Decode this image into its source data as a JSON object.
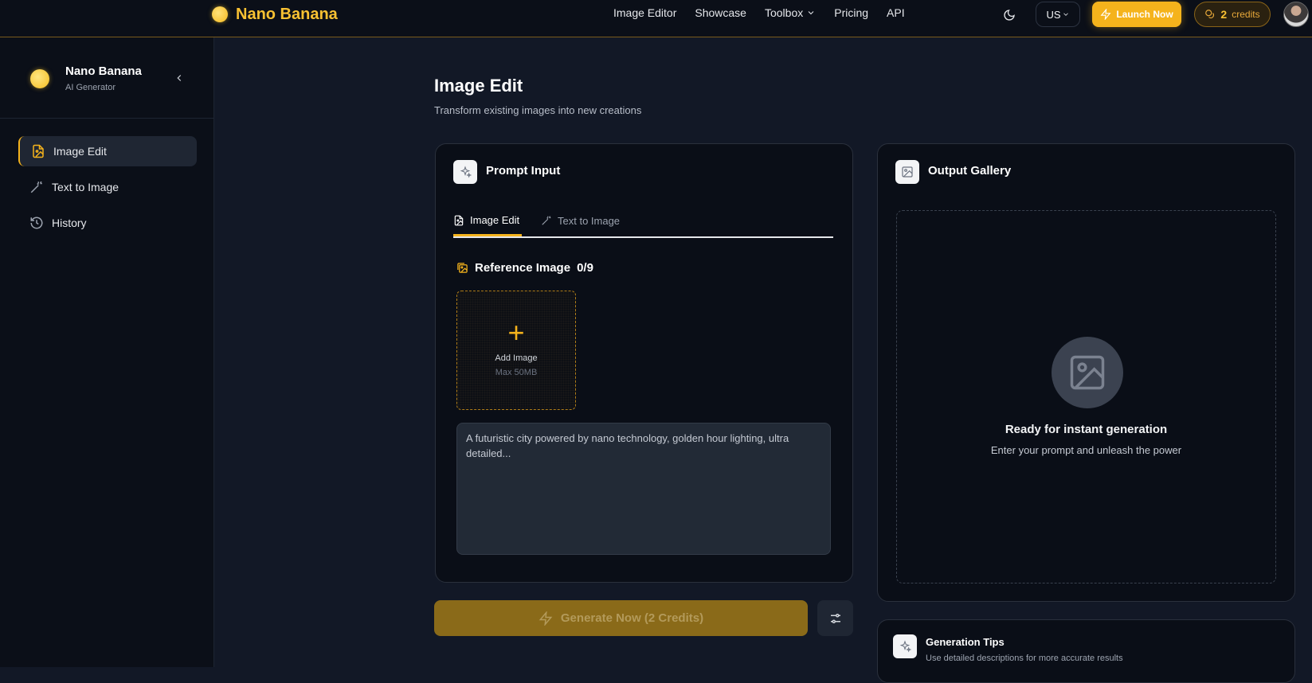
{
  "header": {
    "brand": "Nano Banana",
    "nav": [
      "Image Editor",
      "Showcase",
      "Toolbox",
      "Pricing",
      "API"
    ],
    "lang": "US",
    "launch_label": "Launch Now",
    "credits_count": "2",
    "credits_label": "credits"
  },
  "sidebar": {
    "title": "Nano Banana",
    "subtitle": "AI Generator",
    "items": [
      {
        "label": "Image Edit",
        "icon": "image-edit-icon",
        "active": true
      },
      {
        "label": "Text to Image",
        "icon": "magic-wand-icon"
      },
      {
        "label": "History",
        "icon": "history-icon"
      }
    ]
  },
  "main": {
    "title": "Image Edit",
    "subtitle": "Transform existing images into new creations",
    "prompt_card": {
      "title": "Prompt Input",
      "tabs": [
        "Image Edit",
        "Text to Image"
      ],
      "reference_label": "Reference Image",
      "reference_count": "0/9",
      "add_image": "Add Image",
      "max_size": "Max 50MB",
      "prompt_placeholder": "A futuristic city powered by nano technology, golden hour lighting, ultra detailed..."
    },
    "generate_label": "Generate Now (2 Credits)",
    "gallery": {
      "title": "Output Gallery",
      "ready_title": "Ready for instant generation",
      "ready_sub": "Enter your prompt and unleash the power"
    },
    "tips": {
      "title": "Generation Tips",
      "text": "Use detailed descriptions for more accurate results"
    }
  },
  "colors": {
    "accent": "#f5b31c",
    "background": "#121826",
    "panel": "#0a0e17"
  }
}
